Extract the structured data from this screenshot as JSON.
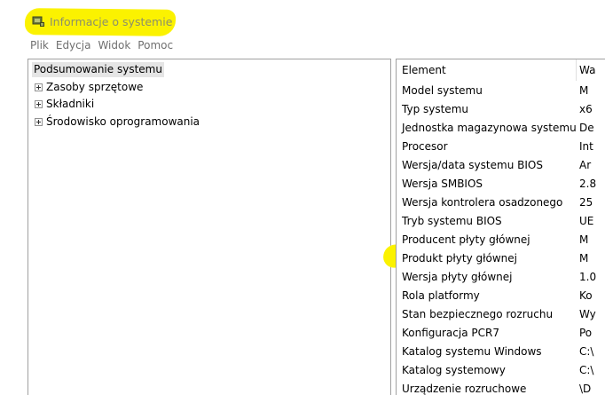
{
  "window": {
    "title": "Informacje o systemie",
    "highlight_color": "#fbf200"
  },
  "menu": [
    "Plik",
    "Edycja",
    "Widok",
    "Pomoc"
  ],
  "tree": {
    "root": "Podsumowanie systemu",
    "children": [
      "Zasoby sprzętowe",
      "Składniki",
      "Środowisko oprogramowania"
    ]
  },
  "list": {
    "columns": [
      "Element",
      "Wa"
    ],
    "rows": [
      {
        "element": "Model systemu",
        "value": "M"
      },
      {
        "element": "Typ systemu",
        "value": "x6"
      },
      {
        "element": "Jednostka magazynowa systemu",
        "value": "De"
      },
      {
        "element": "Procesor",
        "value": "Int"
      },
      {
        "element": "Wersja/data systemu BIOS",
        "value": "Ar"
      },
      {
        "element": "Wersja SMBIOS",
        "value": "2.8"
      },
      {
        "element": "Wersja kontrolera osadzonego",
        "value": "25"
      },
      {
        "element": "Tryb systemu BIOS",
        "value": "UE"
      },
      {
        "element": "Producent płyty głównej",
        "value": "M"
      },
      {
        "element": "Produkt płyty głównej",
        "value": "M"
      },
      {
        "element": "Wersja płyty głównej",
        "value": "1.0"
      },
      {
        "element": "Rola platformy",
        "value": "Ko"
      },
      {
        "element": "Stan bezpiecznego rozruchu",
        "value": "Wy"
      },
      {
        "element": "Konfiguracja PCR7",
        "value": "Po"
      },
      {
        "element": "Katalog systemu Windows",
        "value": "C:\\"
      },
      {
        "element": "Katalog systemowy",
        "value": "C:\\"
      },
      {
        "element": "Urządzenie rozruchowe",
        "value": "\\D"
      }
    ]
  }
}
